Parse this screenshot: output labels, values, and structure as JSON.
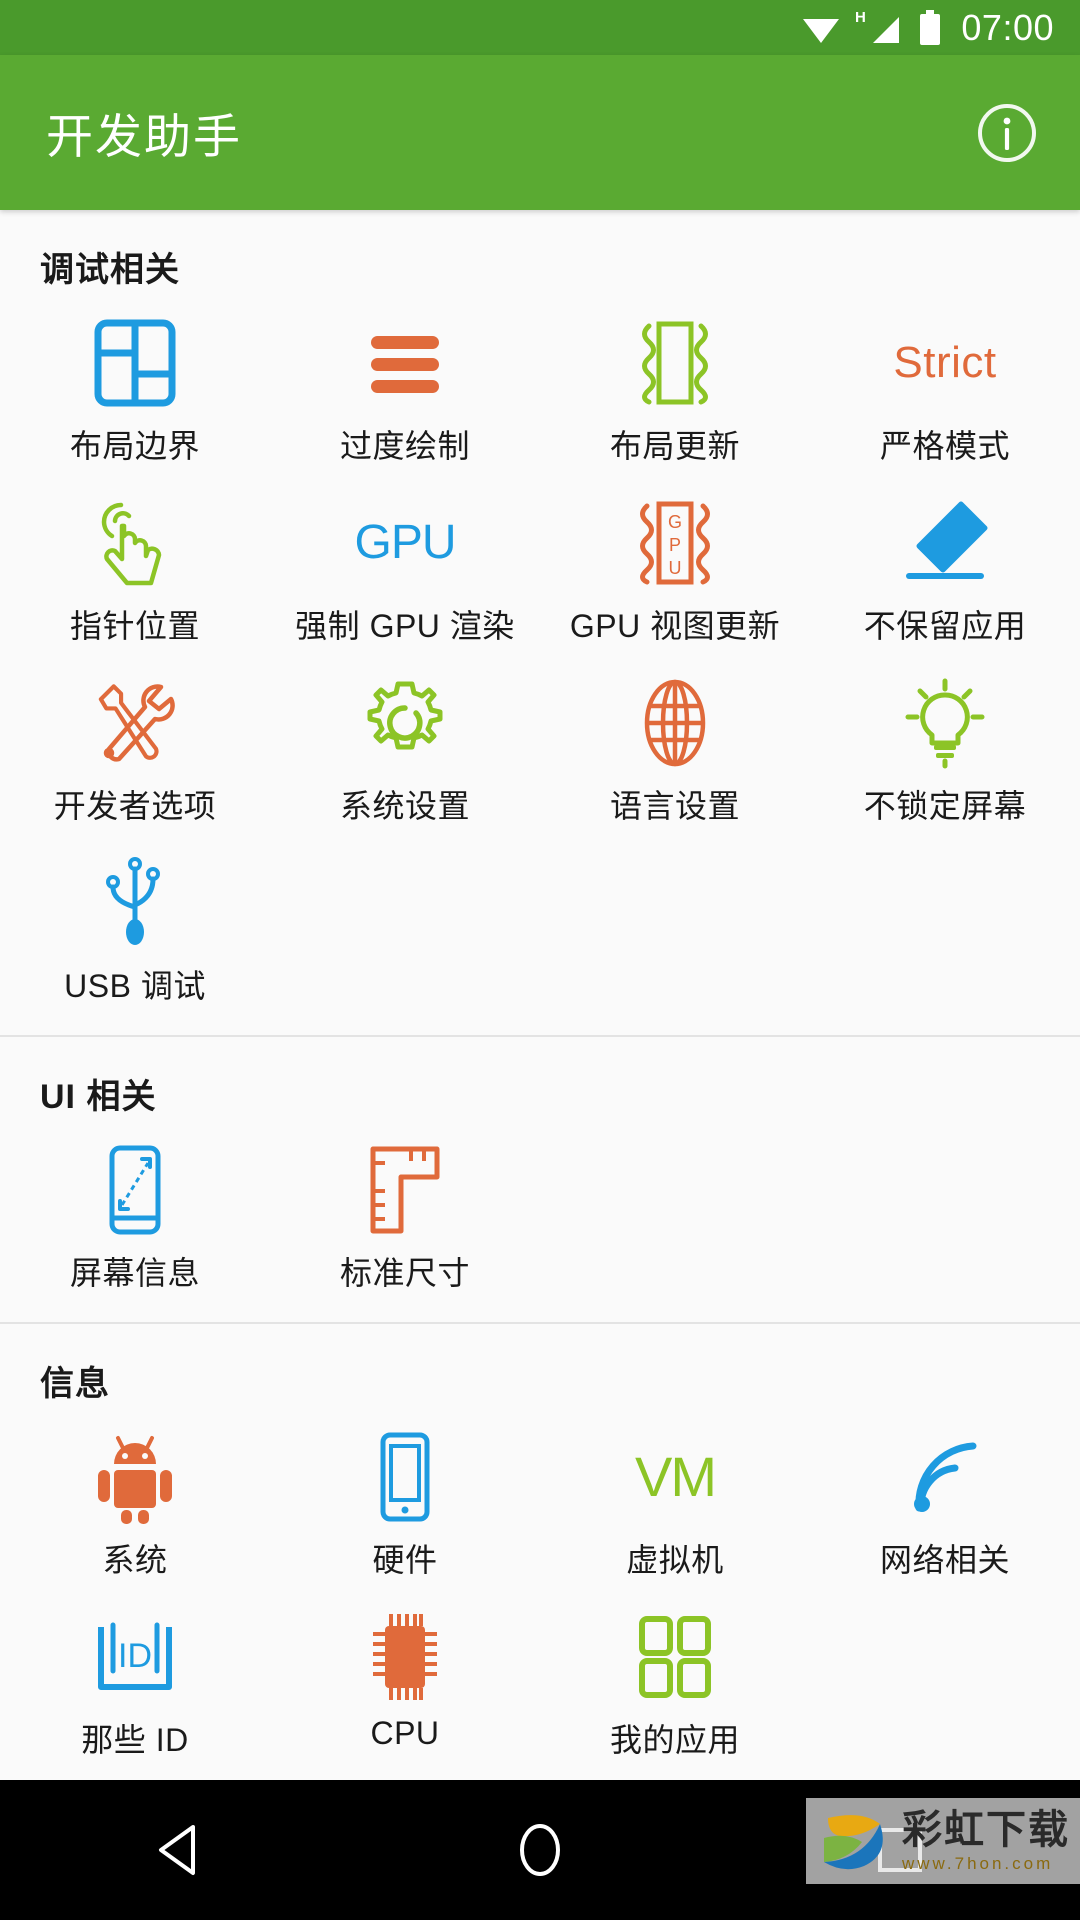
{
  "status_bar": {
    "wifi_icon": "wifi-icon",
    "signal_icon": "signal-h-icon",
    "signal_label": "H",
    "battery_icon": "battery-full-icon",
    "time": "07:00"
  },
  "app_bar": {
    "title": "开发助手",
    "info_icon": "info-icon"
  },
  "theme": {
    "primary": "#5aaa32",
    "primary_dark": "#4a9a2c",
    "background": "#fafafa",
    "blue": "#1e9be0",
    "orange": "#e06a3b",
    "green": "#8cc426",
    "text": "#1a1a1a"
  },
  "sections": [
    {
      "title": "调试相关",
      "items": [
        {
          "label": "布局边界",
          "icon": "layout-bounds-icon",
          "color": "#1e9be0"
        },
        {
          "label": "过度绘制",
          "icon": "overdraw-bars-icon",
          "color": "#e06a3b"
        },
        {
          "label": "布局更新",
          "icon": "layout-update-icon",
          "color": "#8cc426"
        },
        {
          "label": "严格模式",
          "icon": "strict-text-icon",
          "color": "#e06a3b",
          "icon_text": "Strict"
        },
        {
          "label": "指针位置",
          "icon": "pointer-touch-icon",
          "color": "#8cc426"
        },
        {
          "label": "强制 GPU 渲染",
          "icon": "gpu-text-icon",
          "color": "#1e9be0",
          "icon_text": "GPU"
        },
        {
          "label": "GPU 视图更新",
          "icon": "gpu-view-update-icon",
          "color": "#e06a3b",
          "icon_text": "GPU"
        },
        {
          "label": "不保留应用",
          "icon": "eraser-icon",
          "color": "#1e9be0"
        },
        {
          "label": "开发者选项",
          "icon": "tools-icon",
          "color": "#e06a3b"
        },
        {
          "label": "系统设置",
          "icon": "gear-icon",
          "color": "#8cc426"
        },
        {
          "label": "语言设置",
          "icon": "globe-icon",
          "color": "#e06a3b"
        },
        {
          "label": "不锁定屏幕",
          "icon": "lightbulb-icon",
          "color": "#8cc426"
        },
        {
          "label": "USB 调试",
          "icon": "usb-icon",
          "color": "#1e9be0"
        }
      ]
    },
    {
      "title": "UI 相关",
      "items": [
        {
          "label": "屏幕信息",
          "icon": "screen-info-icon",
          "color": "#1e9be0"
        },
        {
          "label": "标准尺寸",
          "icon": "ruler-icon",
          "color": "#e06a3b"
        }
      ]
    },
    {
      "title": "信息",
      "items": [
        {
          "label": "系统",
          "icon": "android-icon",
          "color": "#e06a3b"
        },
        {
          "label": "硬件",
          "icon": "phone-icon",
          "color": "#1e9be0"
        },
        {
          "label": "虚拟机",
          "icon": "vm-text-icon",
          "color": "#8cc426",
          "icon_text": "VM"
        },
        {
          "label": "网络相关",
          "icon": "wifi-signal-icon",
          "color": "#1e9be0"
        },
        {
          "label": "那些 ID",
          "icon": "id-badge-icon",
          "color": "#1e9be0",
          "icon_text": "ID"
        },
        {
          "label": "CPU",
          "icon": "cpu-chip-icon",
          "color": "#e06a3b"
        },
        {
          "label": "我的应用",
          "icon": "apps-grid-icon",
          "color": "#8cc426"
        }
      ]
    }
  ],
  "nav_bar": {
    "back": "back-triangle-icon",
    "home": "home-circle-icon",
    "recents": "recents-square-icon"
  },
  "watermark": {
    "title": "彩虹下载",
    "url": "www.7hon.com"
  }
}
